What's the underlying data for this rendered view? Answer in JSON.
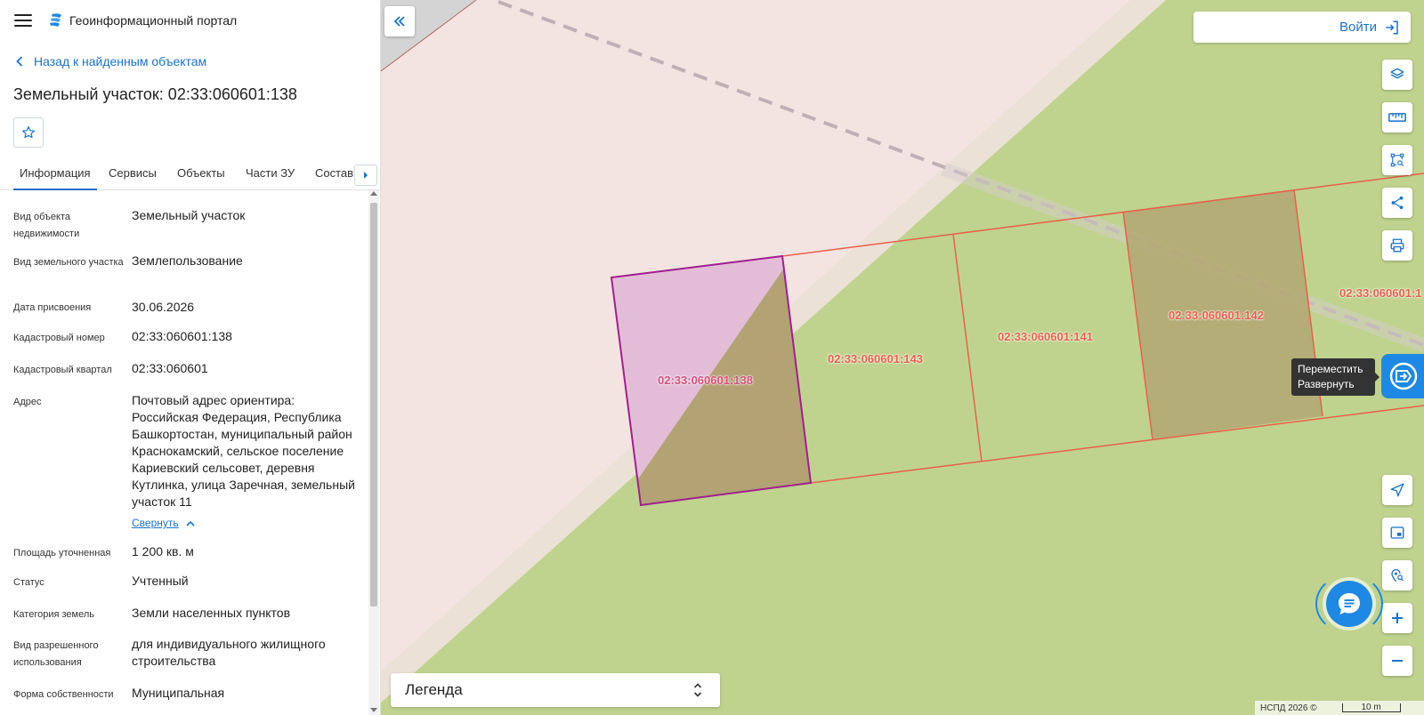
{
  "app": {
    "title": "Геоинформационный портал"
  },
  "nav": {
    "back_label": "Назад к найденным объектам"
  },
  "object": {
    "title": "Земельный участок: 02:33:060601:138"
  },
  "tabs": [
    {
      "label": "Информация",
      "active": true
    },
    {
      "label": "Сервисы",
      "active": false
    },
    {
      "label": "Объекты",
      "active": false
    },
    {
      "label": "Части ЗУ",
      "active": false
    },
    {
      "label": "Состав",
      "active": false
    }
  ],
  "properties": [
    {
      "label": "Вид объекта недвижимости",
      "value": "Земельный участок"
    },
    {
      "label": "Вид земельного участка",
      "value": "Землепользование"
    },
    {
      "label": "Дата присвоения",
      "value": "30.06.2026"
    },
    {
      "label": "Кадастровый номер",
      "value": "02:33:060601:138"
    },
    {
      "label": "Кадастровый квартал",
      "value": "02:33:060601"
    },
    {
      "label": "Адрес",
      "value": "Почтовый адрес ориентира: Российская Федерация, Республика Башкортостан, муниципальный район Краснокамский, сельское поселение Кариевский сельсовет, деревня Кутлинка, улица Заречная, земельный участок 11"
    },
    {
      "label": "Площадь уточненная",
      "value": "1 200 кв. м"
    },
    {
      "label": "Статус",
      "value": "Учтенный"
    },
    {
      "label": "Категория земель",
      "value": "Земли населенных пунктов"
    },
    {
      "label": "Вид разрешенного использования",
      "value": "для индивидуального жилищного строительства"
    },
    {
      "label": "Форма собственности",
      "value": "Муниципальная"
    }
  ],
  "collapse_label": "Свернуть",
  "map": {
    "login_label": "Войти",
    "parcels": [
      {
        "label": "02:33:060601:138",
        "selected": true
      },
      {
        "label": "02:33:060601:143",
        "selected": false
      },
      {
        "label": "02:33:060601:141",
        "selected": false
      },
      {
        "label": "02:33:060601:142",
        "selected": false
      },
      {
        "label": "02:33:060601:1",
        "selected": false
      }
    ],
    "tooltip": {
      "line1": "Переместить",
      "line2": "Развернуть"
    },
    "legend_label": "Легенда",
    "attribution": "НСПД 2026 ©",
    "scale_label": "10 m"
  },
  "colors": {
    "accent": "#1a73c9",
    "button_blue": "#1e88e5",
    "parcel_line": "#e8604b",
    "selected_outline": "#a0208e",
    "map_green": "#bfd38e",
    "map_pink": "#f3e4e2"
  },
  "icons": {
    "menu": "burger-menu-icon",
    "logo": "portal-logo-icon",
    "back": "chevron-left-icon",
    "favorite": "star-icon",
    "tabs_next": "caret-right-icon",
    "collapse_panel": "double-chevron-left-icon",
    "login": "sign-in-icon",
    "layers": "layers-icon",
    "ruler": "ruler-icon",
    "select_area": "area-select-icon",
    "share": "share-icon",
    "print": "print-icon",
    "locate": "navigation-arrow-icon",
    "minimap": "minimap-icon",
    "geo_search": "location-search-icon",
    "zoom_in": "plus-icon",
    "zoom_out": "minus-icon",
    "chat": "chat-icon",
    "drag": "drag-handle-icon"
  }
}
